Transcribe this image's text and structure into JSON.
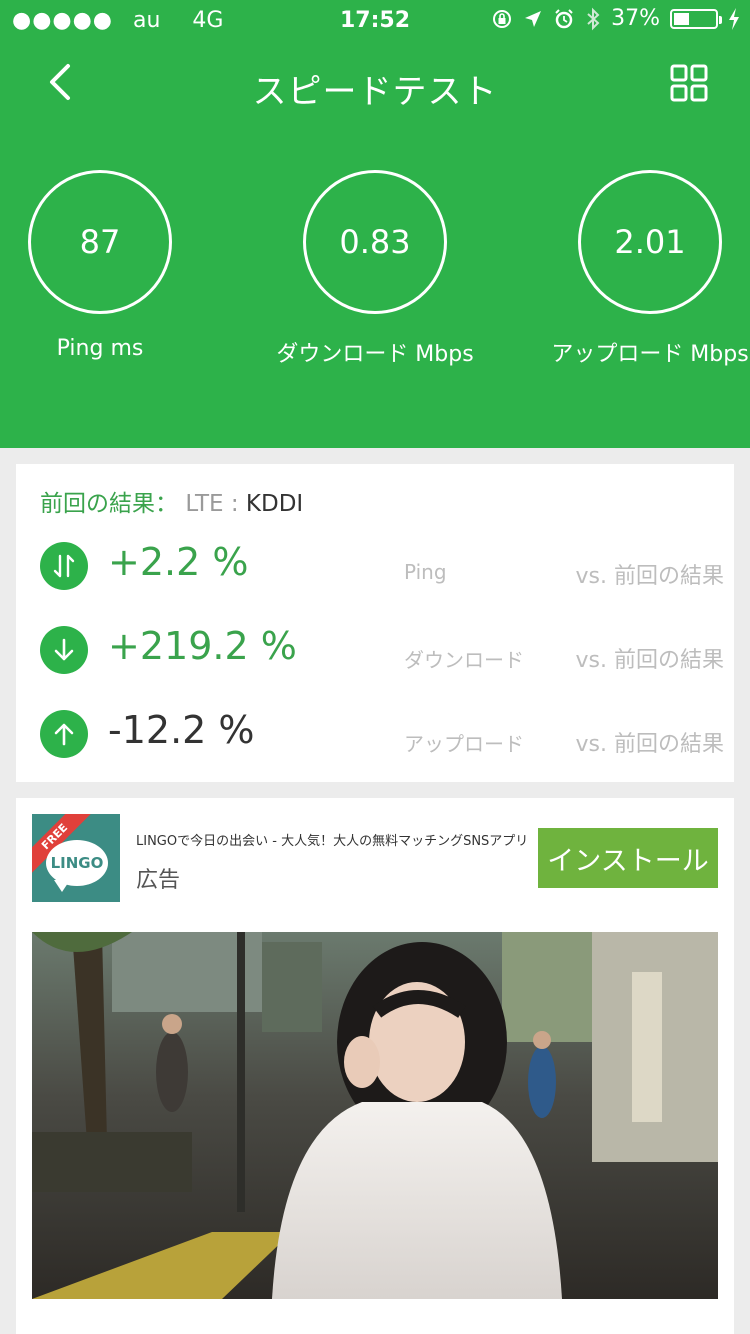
{
  "status": {
    "signal": "●●●●●",
    "carrier": "au",
    "network": "4G",
    "time": "17:52",
    "battery": "37%",
    "battery_level": 0.37
  },
  "header": {
    "title": "スピードテスト"
  },
  "metrics": [
    {
      "value": "87",
      "label": "Ping ms"
    },
    {
      "value": "0.83",
      "label": "ダウンロード Mbps"
    },
    {
      "value": "2.01",
      "label": "アップロード Mbps"
    }
  ],
  "results": {
    "heading_label": "前回の結果：",
    "network_type": "LTE :",
    "operator": "KDDI",
    "rows": [
      {
        "icon": "ping-arrows-icon",
        "percent": "+2.2 %",
        "metric": "Ping",
        "compare": "vs. 前回の結果"
      },
      {
        "icon": "download-arrow-icon",
        "percent": "+219.2 %",
        "metric": "ダウンロード",
        "compare": "vs. 前回の結果"
      },
      {
        "icon": "upload-arrow-icon",
        "percent": "-12.2 %",
        "metric": "アップロード",
        "compare": "vs. 前回の結果"
      }
    ]
  },
  "ad": {
    "logo_text": "LINGO",
    "logo_badge": "FREE",
    "description": "LINGOで今日の出会い - 大人気！大人の無料マッチングSNSアプリ",
    "tag": "広告",
    "install_label": "インストール"
  },
  "colors": {
    "brand_green": "#2db24a",
    "text_green": "#3aa34c",
    "install_green": "#6fb33e",
    "muted_gray": "#bdbdbd"
  }
}
